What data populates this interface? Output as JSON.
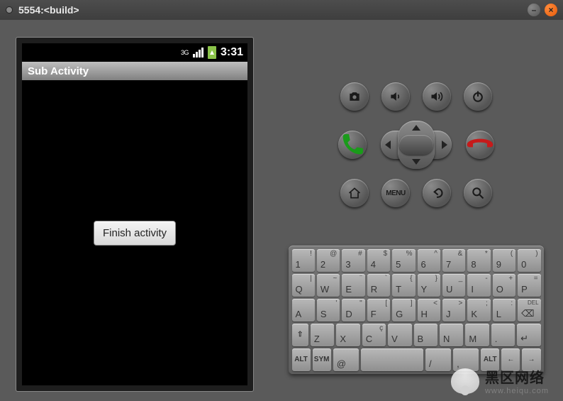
{
  "window": {
    "title": "5554:<build>"
  },
  "statusbar": {
    "net": "3G",
    "clock": "3:31"
  },
  "app": {
    "activity_title": "Sub Activity",
    "button_label": "Finish activity"
  },
  "hw_buttons": {
    "row1": [
      "camera-icon",
      "volume-down-icon",
      "volume-up-icon",
      "power-icon"
    ],
    "call": "call-icon",
    "end": "end-call-icon",
    "dpad": [
      "dpad-up",
      "dpad-down",
      "dpad-left",
      "dpad-right",
      "dpad-center"
    ],
    "row3": [
      "home-icon",
      "menu-button",
      "back-icon",
      "search-icon"
    ],
    "menu_label": "MENU"
  },
  "keyboard": {
    "row1": [
      {
        "main": "1",
        "sup": "!"
      },
      {
        "main": "2",
        "sup": "@"
      },
      {
        "main": "3",
        "sup": "#"
      },
      {
        "main": "4",
        "sup": "$"
      },
      {
        "main": "5",
        "sup": "%"
      },
      {
        "main": "6",
        "sup": "^"
      },
      {
        "main": "7",
        "sup": "&"
      },
      {
        "main": "8",
        "sup": "*"
      },
      {
        "main": "9",
        "sup": "("
      },
      {
        "main": "0",
        "sup": ")"
      }
    ],
    "row2": [
      {
        "main": "Q",
        "sup": "|"
      },
      {
        "main": "W",
        "sup": "~"
      },
      {
        "main": "E",
        "sup": "¨"
      },
      {
        "main": "R",
        "sup": "`"
      },
      {
        "main": "T",
        "sup": "{"
      },
      {
        "main": "Y",
        "sup": "}"
      },
      {
        "main": "U",
        "sup": "_"
      },
      {
        "main": "I",
        "sup": "-"
      },
      {
        "main": "O",
        "sup": "+"
      },
      {
        "main": "P",
        "sup": "="
      }
    ],
    "row3": [
      {
        "main": "A",
        "sup": ""
      },
      {
        "main": "S",
        "sup": "'"
      },
      {
        "main": "D",
        "sup": "\""
      },
      {
        "main": "F",
        "sup": "["
      },
      {
        "main": "G",
        "sup": "]"
      },
      {
        "main": "H",
        "sup": "<"
      },
      {
        "main": "J",
        "sup": ">"
      },
      {
        "main": "K",
        "sup": ";"
      },
      {
        "main": "L",
        "sup": ":"
      }
    ],
    "row3_del": "DEL",
    "row4_shift": "⇧",
    "row4": [
      {
        "main": "Z",
        "sup": ""
      },
      {
        "main": "X",
        "sup": ""
      },
      {
        "main": "C",
        "sup": "ç"
      },
      {
        "main": "V",
        "sup": ""
      },
      {
        "main": "B",
        "sup": ""
      },
      {
        "main": "N",
        "sup": ""
      },
      {
        "main": "M",
        "sup": ""
      },
      {
        "main": ".",
        "sup": ""
      },
      {
        "main": "↵",
        "sup": ""
      }
    ],
    "row5": {
      "alt": "ALT",
      "sym": "SYM",
      "at": "@",
      "space": "",
      "slash": "/",
      "comma": ",",
      "alt2": "ALT",
      "left": "←",
      "right": "→"
    }
  },
  "watermark": {
    "cn": "黑区网络",
    "url": "www.heiqu.com"
  }
}
